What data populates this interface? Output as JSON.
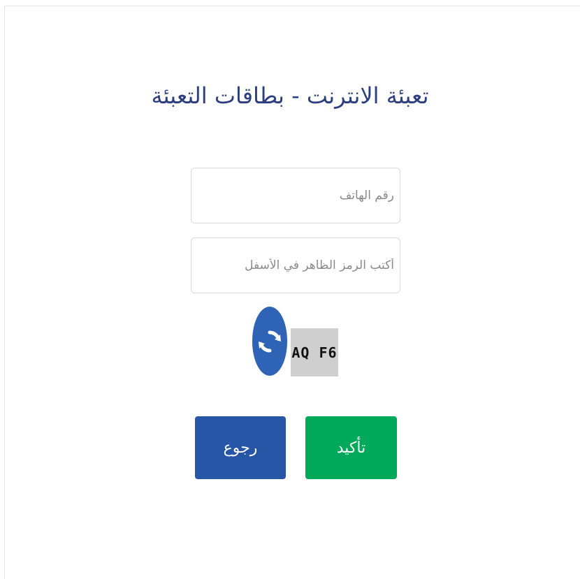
{
  "page": {
    "title": "تعبئة الانترنت - بطاقات التعبئة"
  },
  "form": {
    "phone_placeholder": "رقم الهاتف",
    "code_placeholder": "أكتب الرمز الظاهر في الأسفل",
    "captcha_text": "AQ F6"
  },
  "actions": {
    "back_label": "رجوع",
    "confirm_label": "تأكيد"
  },
  "colors": {
    "title": "#2c3e7f",
    "refresh": "#2f63b5",
    "back_button": "#2756a6",
    "confirm_button": "#00a859",
    "captcha_bg": "#cfcfcf"
  },
  "icons": {
    "refresh": "refresh-icon"
  }
}
